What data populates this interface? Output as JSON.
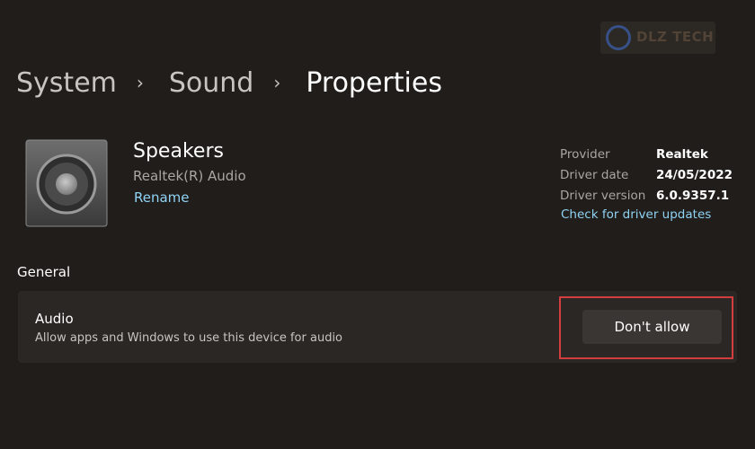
{
  "watermark": {
    "text": "DLZ TECH"
  },
  "breadcrumb": {
    "items": [
      "System",
      "Sound",
      "Properties"
    ],
    "separator": "›"
  },
  "device": {
    "icon": "speaker-icon",
    "name": "Speakers",
    "subtitle": "Realtek(R) Audio",
    "rename_label": "Rename"
  },
  "driver": {
    "provider_label": "Provider",
    "provider_value": "Realtek",
    "date_label": "Driver date",
    "date_value": "24/05/2022",
    "version_label": "Driver version",
    "version_value": "6.0.9357.1",
    "update_link": "Check for driver updates"
  },
  "general": {
    "heading": "General",
    "audio": {
      "title": "Audio",
      "description": "Allow apps and Windows to use this device for audio",
      "button_label": "Don't allow"
    }
  },
  "colors": {
    "background": "#211d1a",
    "card": "#2b2725",
    "accent_link": "#8fd3f4",
    "highlight": "#d33d3d"
  }
}
